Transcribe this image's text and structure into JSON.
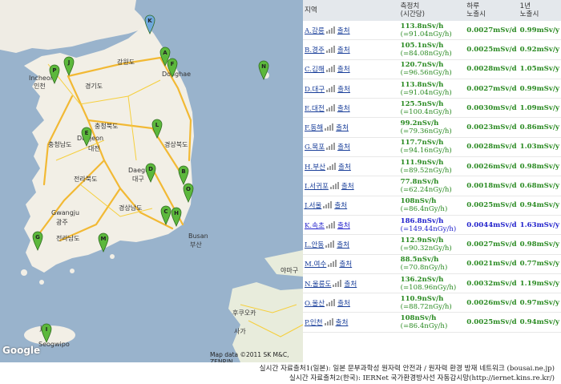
{
  "map": {
    "copyright": "Map data ©2011 SK M&C, ZENRIN",
    "logo": "Google",
    "city_labels": [
      {
        "name": "Incheon",
        "cls": "lbl"
      },
      {
        "name": "인천",
        "cls": "lbl"
      },
      {
        "name": "강원도",
        "cls": "lbl"
      },
      {
        "name": "경기도",
        "cls": "lbl"
      },
      {
        "name": "충청북도",
        "cls": "lbl"
      },
      {
        "name": "충청남도",
        "cls": "lbl"
      },
      {
        "name": "Daejeon",
        "cls": "lbl"
      },
      {
        "name": "대전",
        "cls": "lbl"
      },
      {
        "name": "경상북도",
        "cls": "lbl"
      },
      {
        "name": "전라북도",
        "cls": "lbl"
      },
      {
        "name": "Daegu",
        "cls": "lbl"
      },
      {
        "name": "대구",
        "cls": "lbl"
      },
      {
        "name": "경상남도",
        "cls": "lbl"
      },
      {
        "name": "Gwangju",
        "cls": "lbl"
      },
      {
        "name": "광주",
        "cls": "lbl"
      },
      {
        "name": "전라남도",
        "cls": "lbl"
      },
      {
        "name": "Busan",
        "cls": "lbl"
      },
      {
        "name": "부산",
        "cls": "lbl"
      },
      {
        "name": "Jeju",
        "cls": "lbl"
      },
      {
        "name": "Seogwipo",
        "cls": "lbl"
      },
      {
        "name": "후쿠오카",
        "cls": "lbl"
      },
      {
        "name": "사가",
        "cls": "lbl"
      },
      {
        "name": "야마구",
        "cls": "lbl"
      },
      {
        "name": "Donghae",
        "cls": "lbl"
      }
    ],
    "markers": [
      "A",
      "B",
      "C",
      "D",
      "E",
      "F",
      "G",
      "H",
      "I",
      "J",
      "K",
      "L",
      "M",
      "N",
      "O",
      "P"
    ]
  },
  "table": {
    "headers": [
      "지역",
      "측정치\n(시간당)",
      "하루\n노출시",
      "1년\n노출시"
    ],
    "source_label": "출처",
    "rows": [
      {
        "loc": "A.강릉",
        "val": "113.8nSv/h",
        "sub": "(=91.04nGy/h)",
        "daily": "0.0027mSv/d",
        "yearly": "0.99mSv/y"
      },
      {
        "loc": "B.경주",
        "val": "105.1nSv/h",
        "sub": "(=84.08nGy/h)",
        "daily": "0.0025mSv/d",
        "yearly": "0.92mSv/y"
      },
      {
        "loc": "C.김해",
        "val": "120.7nSv/h",
        "sub": "(=96.56nGy/h)",
        "daily": "0.0028mSv/d",
        "yearly": "1.05mSv/y"
      },
      {
        "loc": "D.대구",
        "val": "113.8nSv/h",
        "sub": "(=91.04nGy/h)",
        "daily": "0.0027mSv/d",
        "yearly": "0.99mSv/y"
      },
      {
        "loc": "E.대전",
        "val": "125.5nSv/h",
        "sub": "(=100.4nGy/h)",
        "daily": "0.0030mSv/d",
        "yearly": "1.09mSv/y"
      },
      {
        "loc": "F.동해",
        "val": "99.2nSv/h",
        "sub": "(=79.36nGy/h)",
        "daily": "0.0023mSv/d",
        "yearly": "0.86mSv/y"
      },
      {
        "loc": "G.목포",
        "val": "117.7nSv/h",
        "sub": "(=94.16nGy/h)",
        "daily": "0.0028mSv/d",
        "yearly": "1.03mSv/y"
      },
      {
        "loc": "H.부산",
        "val": "111.9nSv/h",
        "sub": "(=89.52nGy/h)",
        "daily": "0.0026mSv/d",
        "yearly": "0.98mSv/y"
      },
      {
        "loc": "I.서귀포",
        "val": "77.8nSv/h",
        "sub": "(=62.24nGy/h)",
        "daily": "0.0018mSv/d",
        "yearly": "0.68mSv/y"
      },
      {
        "loc": "J.서울",
        "val": "108nSv/h",
        "sub": "(=86.4nGy/h)",
        "daily": "0.0025mSv/d",
        "yearly": "0.94mSv/y"
      },
      {
        "loc": "K.속초",
        "val": "186.8nSv/h",
        "sub": "(=149.44nGy/h)",
        "daily": "0.0044mSv/d",
        "yearly": "1.63mSv/y",
        "alert": true
      },
      {
        "loc": "L.안동",
        "val": "112.9nSv/h",
        "sub": "(=90.32nGy/h)",
        "daily": "0.0027mSv/d",
        "yearly": "0.98mSv/y"
      },
      {
        "loc": "M.여수",
        "val": "88.5nSv/h",
        "sub": "(=70.8nGy/h)",
        "daily": "0.0021mSv/d",
        "yearly": "0.77mSv/y"
      },
      {
        "loc": "N.울릉도",
        "val": "136.2nSv/h",
        "sub": "(=108.96nGy/h)",
        "daily": "0.0032mSv/d",
        "yearly": "1.19mSv/y"
      },
      {
        "loc": "O.울산",
        "val": "110.9nSv/h",
        "sub": "(=88.72nGy/h)",
        "daily": "0.0026mSv/d",
        "yearly": "0.97mSv/y"
      },
      {
        "loc": "P.인천",
        "val": "108nSv/h",
        "sub": "(=86.4nGy/h)",
        "daily": "0.0025mSv/d",
        "yearly": "0.94mSv/y"
      }
    ]
  },
  "footer": {
    "line1": "실시간 자료출처1(일본): 일본 문부과학성 원자력 안전과 / 원자력 환경 방재 네트워크 (bousai.ne.jp)",
    "line2": "실시간 자료출처2(한국): IERNet 국가환경방사선 자동감시망(http://iernet.kins.re.kr/)"
  },
  "colors": {
    "marker": "#5cb83c",
    "sea": "#99b3cc",
    "land": "#f2efe6",
    "road": "#f6cf3c",
    "highway": "#f2b934",
    "alert": "#2222cc",
    "value": "#2a8a22"
  }
}
